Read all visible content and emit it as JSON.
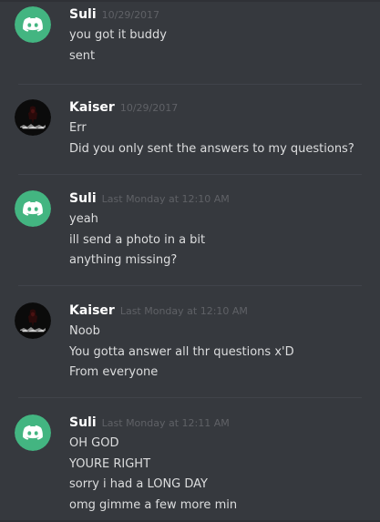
{
  "messages": [
    {
      "author": "Suli",
      "avatar": "discord-logo-avatar",
      "timestamp": "10/29/2017",
      "lines": [
        "you got it buddy",
        "sent"
      ]
    },
    {
      "author": "Kaiser",
      "avatar": "dark-photo-avatar",
      "timestamp": "10/29/2017",
      "lines": [
        "Err",
        "Did you only sent the answers to my questions?"
      ]
    },
    {
      "author": "Suli",
      "avatar": "discord-logo-avatar",
      "timestamp": "Last Monday at 12:10 AM",
      "lines": [
        "yeah",
        "ill send a photo in a bit",
        "anything missing?"
      ]
    },
    {
      "author": "Kaiser",
      "avatar": "dark-photo-avatar",
      "timestamp": "Last Monday at 12:10 AM",
      "lines": [
        "Noob",
        "You gotta answer all thr questions x'D",
        "From everyone"
      ]
    },
    {
      "author": "Suli",
      "avatar": "discord-logo-avatar",
      "timestamp": "Last Monday at 12:11 AM",
      "lines": [
        "OH GOD",
        "YOURE RIGHT",
        "sorry i had a LONG DAY",
        "omg gimme a few more min"
      ]
    }
  ],
  "colors": {
    "background": "#36393e",
    "username": "#ffffff",
    "timestamp": "#5f6166",
    "text": "#dcddde",
    "discord_avatar_bg": "#43b581",
    "divider": "#40434a"
  }
}
